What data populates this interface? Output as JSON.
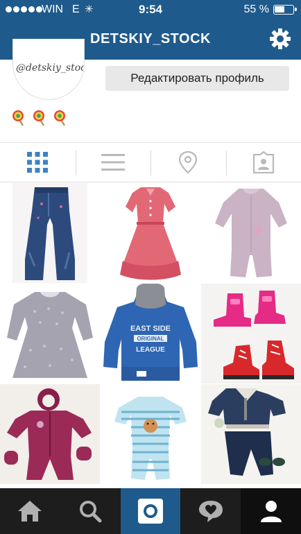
{
  "status_bar": {
    "carrier": "WIN",
    "network": "E",
    "time": "9:54",
    "battery": "55 %"
  },
  "header": {
    "title": "DETSKIY_STOCK"
  },
  "profile": {
    "avatar_text": "@detskiy_stock",
    "edit_button": "Редактировать профиль",
    "bio_icons": [
      "lollipop-icon",
      "lollipop-icon",
      "lollipop-icon"
    ]
  },
  "view_tabs": [
    {
      "name": "grid-view-icon",
      "active": true
    },
    {
      "name": "list-view-icon",
      "active": false
    },
    {
      "name": "location-pin-icon",
      "active": false
    },
    {
      "name": "tagged-photos-icon",
      "active": false
    }
  ],
  "photos": [
    {
      "subject": "jeans"
    },
    {
      "subject": "red dress"
    },
    {
      "subject": "sleepsuit"
    },
    {
      "subject": "grey dress"
    },
    {
      "subject": "blue hoodie",
      "print": [
        "EAST SIDE",
        "ORIGINAL",
        "LEAGUE"
      ]
    },
    {
      "subject": "pink and red boots"
    },
    {
      "subject": "snowsuit"
    },
    {
      "subject": "striped romper"
    },
    {
      "subject": "jacket and trousers"
    }
  ],
  "bottom_nav": [
    {
      "name": "home-icon",
      "active": false
    },
    {
      "name": "search-icon",
      "active": false
    },
    {
      "name": "camera-icon",
      "active": true
    },
    {
      "name": "activity-icon",
      "active": false
    },
    {
      "name": "profile-icon",
      "active": false
    }
  ],
  "colors": {
    "header_bg": "#1f5a8c",
    "tab_active": "#3f81c4",
    "tab_inactive": "#b9b9b9",
    "bottom_bar": "#1d1d1d"
  }
}
